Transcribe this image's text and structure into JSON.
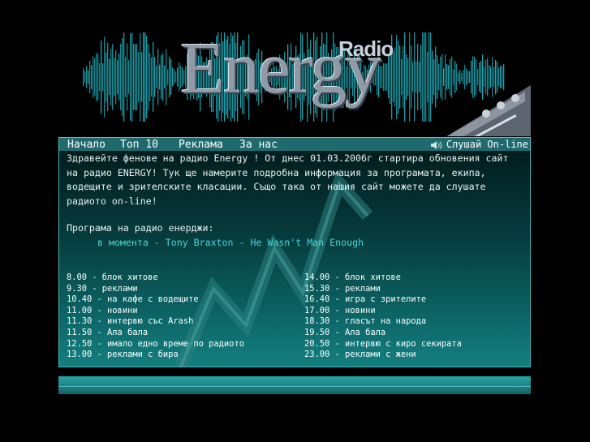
{
  "header": {
    "logo_radio": "Radio",
    "logo_energy": "Energy"
  },
  "nav": {
    "items": [
      {
        "label": "Начало"
      },
      {
        "label": "Топ 10"
      },
      {
        "label": "Реклама"
      },
      {
        "label": "За нас"
      }
    ],
    "listen_label": "Слушай On-line",
    "listen_icon": "speaker-icon"
  },
  "content": {
    "intro_text": "Здравейте фенове на радио Energy ! От днес 01.03.2006г стартира обновения сайт на радио ENERGY! Тук ще намерите подробна информация за програмата, екипа, водещите и зрителските класации. Също така от нашия сайт можете да слушате радиото on-line!",
    "program_heading": "Програма на радио енерджи:",
    "now_playing": "в момента - Tony Braxton - He Wasn't Man Enough"
  },
  "schedule": {
    "left": [
      "8.00 - блок хитове",
      "9.30 - реклами",
      "10.40 - на кафе с водещите",
      "11.00 - новини",
      "11.30 - интервю със Arash",
      "11.50 - Ала бала",
      "12.50 - имало едно време по радиото",
      "13.00 - реклами с бира"
    ],
    "right": [
      "14.00 - блок хитове",
      "15.30 - реклами",
      "16.40 - игра с зрителите",
      "17.00 - новини",
      "18.30 - гласът на народа",
      "19.50 - Ала бала",
      "20.50 - интервю с киро секирата",
      "23.00 - реклами с жени"
    ]
  },
  "colors": {
    "nav_bg": "#1f6a6e",
    "accent": "#46d6d8",
    "wave": "#1fa9b5"
  }
}
